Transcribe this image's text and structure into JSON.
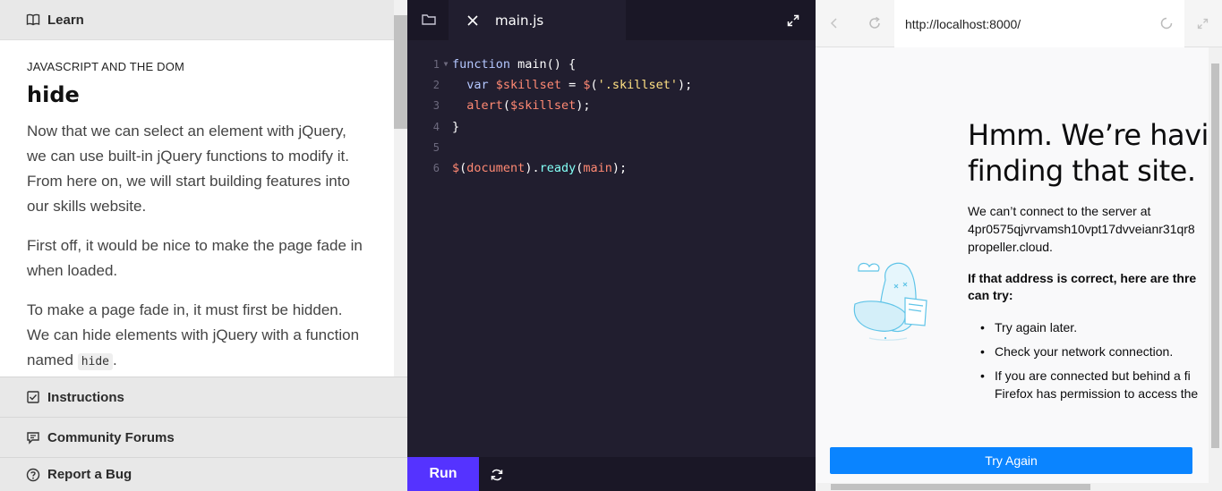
{
  "left": {
    "header": {
      "label": "Learn",
      "icon": "book-icon"
    },
    "kicker": "JAVASCRIPT AND THE DOM",
    "title": "hide",
    "paragraphs": [
      "Now that we can select an element with jQuery, we can use built-in jQuery functions to modify it. From here on, we will start building features into our skills website.",
      "First off, it would be nice to make the page fade in when loaded."
    ],
    "para3_before": "To make a page fade in, it must first be hidden. We can hide elements with jQuery with a function named ",
    "para3_code": "hide",
    "para3_after": ".",
    "footer": [
      {
        "label": "Instructions",
        "icon": "checkbox-icon"
      },
      {
        "label": "Community Forums",
        "icon": "chat-icon"
      },
      {
        "label": "Report a Bug",
        "icon": "help-circle-icon"
      }
    ]
  },
  "editor": {
    "tab_label": "main.js",
    "line_numbers": [
      "1",
      "2",
      "3",
      "4",
      "5",
      "6"
    ],
    "code": {
      "l1_kw": "function",
      "l1_rest": " main() {",
      "l2_kw": "var",
      "l2_var": "$skillset",
      "l2_eq": " = ",
      "l2_fn": "$",
      "l2_open": "(",
      "l2_str": "'.skillset'",
      "l2_close": ");",
      "l3_fn": "alert",
      "l3_open": "(",
      "l3_var": "$skillset",
      "l3_close": ");",
      "l4": "}",
      "l6_fn": "$",
      "l6_open": "(",
      "l6_arg": "document",
      "l6_mid": ").",
      "l6_method": "ready",
      "l6_open2": "(",
      "l6_arg2": "main",
      "l6_close": ");"
    },
    "run_label": "Run"
  },
  "browser": {
    "url": "http://localhost:8000/",
    "error_title_1": "Hmm. We’re having",
    "error_title_2": "finding that site.",
    "desc_1": "We can’t connect to the server at",
    "desc_2": "4pr0575qjvrvamsh10vpt17dvveianr31qr8",
    "desc_3": "propeller.cloud.",
    "bold_1": "If that address is correct, here are thre",
    "bold_2": "can try:",
    "list": [
      [
        "Try again later."
      ],
      [
        "Check your network connection."
      ],
      [
        "If you are connected but behind a fi",
        "Firefox has permission to access the"
      ]
    ],
    "try_again_label": "Try Again"
  },
  "colors": {
    "run": "#5533ff",
    "try_again": "#0a84ff",
    "editor_bg": "#211e2f"
  }
}
